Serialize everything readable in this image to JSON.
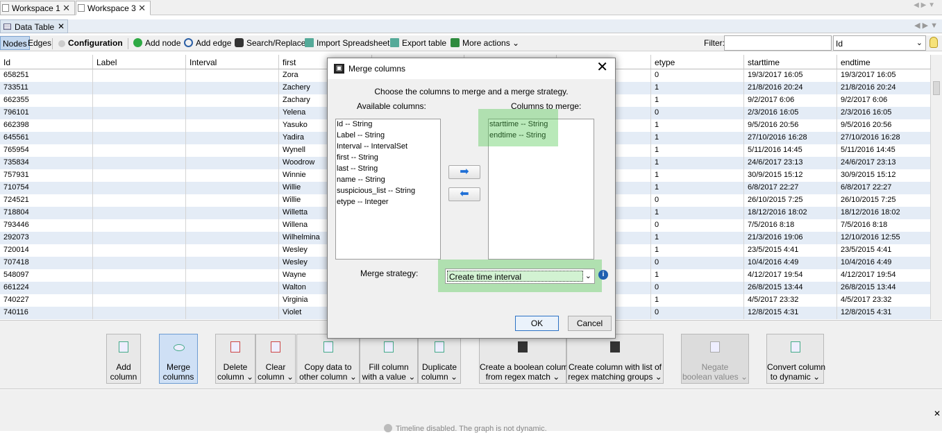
{
  "workspace_tabs": [
    {
      "label": "Workspace 1",
      "close": "✕"
    },
    {
      "label": "Workspace 3",
      "close": "✕"
    }
  ],
  "datatable_tab": {
    "label": "Data Table",
    "close": "✕"
  },
  "toolbar": {
    "nodes": "Nodes",
    "edges": "Edges",
    "configuration": "Configuration",
    "add_node": "Add node",
    "add_edge": "Add edge",
    "search_replace": "Search/Replace",
    "import_spreadsheet": "Import Spreadsheet",
    "export_table": "Export table",
    "more_actions": "More actions",
    "filter_label": "Filter:",
    "filter_value": "",
    "filter_column": "Id"
  },
  "table": {
    "headers": [
      "Id",
      "Label",
      "Interval",
      "first",
      "",
      "",
      "",
      "etype",
      "starttime",
      "endtime"
    ],
    "rows": [
      [
        "658251",
        "",
        "",
        "Zora",
        "",
        "",
        "",
        "0",
        "19/3/2017 16:05",
        "19/3/2017 16:05"
      ],
      [
        "733511",
        "",
        "",
        "Zachery",
        "",
        "",
        "",
        "1",
        "21/8/2016 20:24",
        "21/8/2016 20:24"
      ],
      [
        "662355",
        "",
        "",
        "Zachary",
        "",
        "",
        "",
        "1",
        "9/2/2017 6:06",
        "9/2/2017 6:06"
      ],
      [
        "796101",
        "",
        "",
        "Yelena",
        "",
        "",
        "",
        "0",
        "2/3/2016 16:05",
        "2/3/2016 16:05"
      ],
      [
        "662398",
        "",
        "",
        "Yasuko",
        "",
        "",
        "",
        "1",
        "9/5/2016 20:56",
        "9/5/2016 20:56"
      ],
      [
        "645561",
        "",
        "",
        "Yadira",
        "",
        "",
        "",
        "1",
        "27/10/2016 16:28",
        "27/10/2016 16:28"
      ],
      [
        "765954",
        "",
        "",
        "Wynell",
        "",
        "",
        "",
        "1",
        "5/11/2016 14:45",
        "5/11/2016 14:45"
      ],
      [
        "735834",
        "",
        "",
        "Woodrow",
        "",
        "",
        "",
        "1",
        "24/6/2017 23:13",
        "24/6/2017 23:13"
      ],
      [
        "757931",
        "",
        "",
        "Winnie",
        "",
        "",
        "",
        "1",
        "30/9/2015 15:12",
        "30/9/2015 15:12"
      ],
      [
        "710754",
        "",
        "",
        "Willie",
        "",
        "",
        "",
        "1",
        "6/8/2017 22:27",
        "6/8/2017 22:27"
      ],
      [
        "724521",
        "",
        "",
        "Willie",
        "",
        "",
        "",
        "0",
        "26/10/2015 7:25",
        "26/10/2015 7:25"
      ],
      [
        "718804",
        "",
        "",
        "Willetta",
        "",
        "",
        "",
        "1",
        "18/12/2016 18:02",
        "18/12/2016 18:02"
      ],
      [
        "793446",
        "",
        "",
        "Willena",
        "",
        "",
        "",
        "0",
        "7/5/2016 8:18",
        "7/5/2016 8:18"
      ],
      [
        "292073",
        "",
        "",
        "Wilhelmina",
        "",
        "",
        "",
        "1",
        "21/3/2016 19:06",
        "12/10/2016 12:55"
      ],
      [
        "720014",
        "",
        "",
        "Wesley",
        "",
        "",
        "",
        "1",
        "23/5/2015 4:41",
        "23/5/2015 4:41"
      ],
      [
        "707418",
        "",
        "",
        "Wesley",
        "",
        "",
        "",
        "0",
        "10/4/2016 4:49",
        "10/4/2016 4:49"
      ],
      [
        "548097",
        "",
        "",
        "Wayne",
        "",
        "",
        "",
        "1",
        "4/12/2017 19:54",
        "4/12/2017 19:54"
      ],
      [
        "661224",
        "",
        "",
        "Walton",
        "",
        "",
        "",
        "0",
        "26/8/2015 13:44",
        "26/8/2015 13:44"
      ],
      [
        "740227",
        "",
        "",
        "Virginia",
        "",
        "",
        "",
        "1",
        "4/5/2017 23:32",
        "4/5/2017 23:32"
      ],
      [
        "740116",
        "",
        "",
        "Violet",
        "",
        "",
        "",
        "0",
        "12/8/2015 4:31",
        "12/8/2015 4:31"
      ]
    ]
  },
  "actions": {
    "add_column": "Add\ncolumn",
    "merge_columns": "Merge\ncolumns",
    "delete_column": "Delete\ncolumn ⌄",
    "clear_column": "Clear\ncolumn ⌄",
    "copy_data": "Copy data to\nother column ⌄",
    "fill_column": "Fill column\nwith a value ⌄",
    "duplicate_column": "Duplicate\ncolumn ⌄",
    "boolean_regex": "Create a boolean column\nfrom regex match ⌄",
    "regex_groups": "Create column with list of\nregex matching groups ⌄",
    "negate": "Negate\nboolean values ⌄",
    "convert_dynamic": "Convert column\nto dynamic ⌄"
  },
  "timeline": "Timeline disabled. The graph is not dynamic.",
  "dialog": {
    "title": "Merge columns",
    "instruction": "Choose the columns to merge and a merge strategy.",
    "available_label": "Available columns:",
    "merge_label": "Columns to merge:",
    "available": [
      "Id -- String",
      "Label -- String",
      "Interval -- IntervalSet",
      "first -- String",
      "last -- String",
      "name -- String",
      "suspicious_list -- String",
      "etype -- Integer"
    ],
    "to_merge": [
      "starttime -- String",
      "endtime -- String"
    ],
    "strategy_label": "Merge strategy:",
    "strategy_value": "Create time interval",
    "ok": "OK",
    "cancel": "Cancel",
    "close": "✕"
  },
  "colors": {
    "row_alt": "#e4ecf6",
    "highlight": "#50c850",
    "selected_button": "#cfe0f5"
  }
}
